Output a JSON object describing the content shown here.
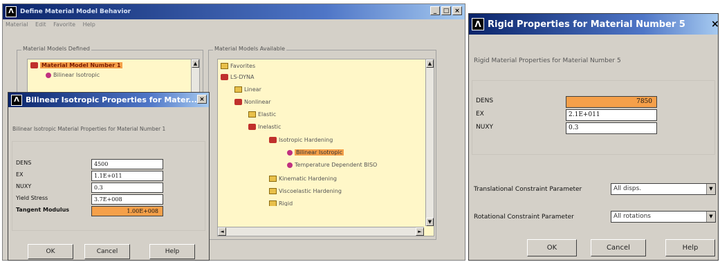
{
  "define_window": {
    "title": "Define Material Model Behavior",
    "menu": [
      "Material",
      "Edit",
      "Favorite",
      "Help"
    ],
    "models_defined_label": "Material Models Defined",
    "defined_items": [
      "Material Model Number 1",
      "Bilinear Isotropic"
    ],
    "models_available_label": "Material Models Available",
    "tree": [
      "Favorites",
      "LS-DYNA",
      "Linear",
      "Nonlinear",
      "Elastic",
      "Inelastic",
      "Isotropic Hardening",
      "Bilinear Isotropic",
      "Temperature Dependent BISO",
      "Kinematic Hardening",
      "Viscoelastic Hardening",
      "Rigid"
    ]
  },
  "bilinear_dialog": {
    "title": "Bilinear Isotropic Properties for Mater...",
    "description": "Bilinear Isotropic Material Properties for Material Number 1",
    "fields": [
      {
        "label": "DENS",
        "value": "4500"
      },
      {
        "label": "EX",
        "value": "1.1E+011"
      },
      {
        "label": "NUXY",
        "value": "0.3"
      },
      {
        "label": "Yield Stress",
        "value": "3.7E+008"
      },
      {
        "label": "Tangent Modulus",
        "value": "1.00E+008"
      }
    ],
    "buttons": {
      "ok": "OK",
      "cancel": "Cancel",
      "help": "Help"
    }
  },
  "rigid_dialog": {
    "title": "Rigid Properties for Material Number 5",
    "description": "Rigid Material Properties for Material Number 5",
    "fields": [
      {
        "label": "DENS",
        "value": "7850"
      },
      {
        "label": "EX",
        "value": "2.1E+011"
      },
      {
        "label": "NUXY",
        "value": "0.3"
      }
    ],
    "translational_label": "Translational Constraint Parameter",
    "translational_value": "All disps.",
    "rotational_label": "Rotational Constraint Parameter",
    "rotational_value": "All rotations",
    "buttons": {
      "ok": "OK",
      "cancel": "Cancel",
      "help": "Help"
    }
  },
  "window_buttons": {
    "minimize": "_",
    "maximize": "□",
    "close": "×"
  },
  "colors": {
    "title_bar": "#0a246a",
    "highlight": "#f5a04a",
    "dialog_bg": "#d4d0c8"
  }
}
